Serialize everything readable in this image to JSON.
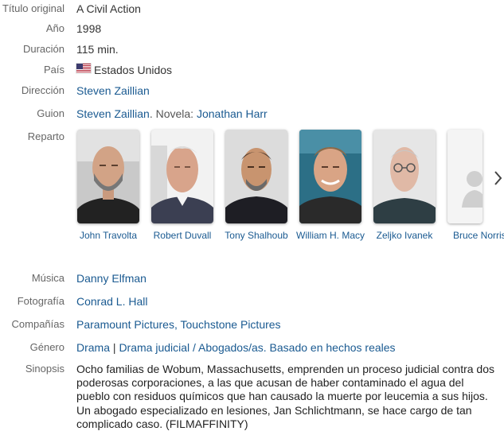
{
  "fields": {
    "titulo": {
      "label": "Título original",
      "value": "A Civil Action"
    },
    "anio": {
      "label": "Año",
      "value": "1998"
    },
    "duracion": {
      "label": "Duración",
      "value": "115 min."
    },
    "pais": {
      "label": "País",
      "value": "Estados Unidos",
      "flag_icon": "us-flag-icon"
    },
    "direccion": {
      "label": "Dirección",
      "value": "Steven Zaillian"
    },
    "guion": {
      "label": "Guion",
      "author": "Steven Zaillian",
      "mid": ". Novela: ",
      "novelist": "Jonathan Harr"
    },
    "reparto": {
      "label": "Reparto"
    },
    "musica": {
      "label": "Música",
      "value": "Danny Elfman"
    },
    "fotografia": {
      "label": "Fotografía",
      "value": "Conrad L. Hall"
    },
    "companias": {
      "label": "Compañías",
      "first": "Paramount Pictures",
      "sep": ", ",
      "second": "Touchstone Pictures"
    },
    "genero": {
      "label": "Género",
      "genre": "Drama",
      "sep": " | ",
      "sub": "Drama judicial / Abogados/as. Basado en hechos reales"
    },
    "sinopsis": {
      "label": "Sinopsis",
      "text": "Ocho familias de Wobum, Massachusetts, emprenden un proceso judicial contra dos poderosas corporaciones, a las que acusan de haber contaminado el agua del pueblo con residuos químicos que han causado la muerte por leucemia a sus hijos. Un abogado especializado en lesiones, Jan Schlichtmann, se hace cargo de tan complicado caso. (FILMAFFINITY)"
    }
  },
  "cast": [
    {
      "name": "John Travolta"
    },
    {
      "name": "Robert Duvall"
    },
    {
      "name": "Tony Shalhoub"
    },
    {
      "name": "William H. Macy"
    },
    {
      "name": "Zeljko Ivanek"
    },
    {
      "name": "Bruce Norris"
    }
  ],
  "icons": {
    "next": "chevron-right-icon",
    "placeholder": "person-placeholder-icon"
  },
  "colors": {
    "link": "#1a5a91",
    "label": "#666666"
  }
}
